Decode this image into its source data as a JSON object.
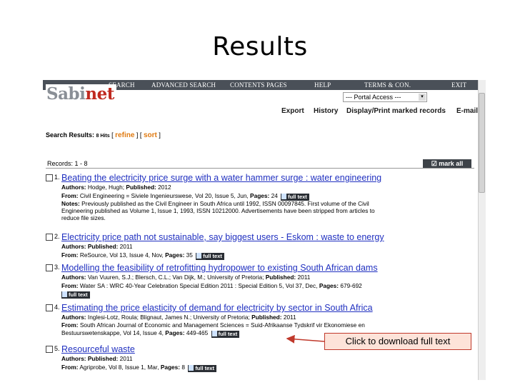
{
  "slide": {
    "title": "Results"
  },
  "nav": {
    "items": [
      "SEARCH",
      "ADVANCED SEARCH",
      "CONTENTS PAGES",
      "HELP",
      "TERMS & CON.",
      "EXIT"
    ],
    "logo_main": "Sabi",
    "logo_accent": "net"
  },
  "portal": {
    "selected": "--- Portal Access ---"
  },
  "toolbar": {
    "export": "Export",
    "history": "History",
    "display_print": "Display/Print marked records",
    "email": "E-mail"
  },
  "search": {
    "label": "Search Results:",
    "hits": "8 Hits",
    "open": "[",
    "refine": "refine",
    "mid": "] [",
    "sort": "sort",
    "close": "]"
  },
  "records_header": {
    "label": "Records: 1 - 8",
    "mark_all": "mark all"
  },
  "full_text_label": "full text",
  "records": [
    {
      "num": "1.",
      "title": "Beating the electricity price surge with a water hammer surge : water engineering",
      "authors_label": "Authors:",
      "authors": "Hodge, Hugh;",
      "published_label": "Published:",
      "published": "2012",
      "from_label": "From:",
      "from": "Civil Engineering = Siviele Ingenieurswese, Vol 20, Issue 5, Jun,",
      "pages_label": "Pages:",
      "pages": "24",
      "notes_label": "Notes:",
      "notes_1": "Previously published as the Civil Engineer in South Africa until 1992, ISSN 00097845. First volume of the Civil",
      "notes_2": "Engineering published as Volume 1, Issue 1, 1993, ISSN 10212000. Advertisements have been stripped from articles to",
      "notes_3": "reduce file sizes."
    },
    {
      "num": "2.",
      "title": "Electricity price path not sustainable, say biggest users - Eskom : waste to energy",
      "authors_label": "Authors:",
      "published_label": "Published:",
      "published": "2011",
      "from_label": "From:",
      "from": "ReSource, Vol 13, Issue 4, Nov,",
      "pages_label": "Pages:",
      "pages": "35"
    },
    {
      "num": "3.",
      "title": "Modelling the feasibility of retrofitting hydropower to existing South African dams",
      "authors_label": "Authors:",
      "authors": "Van Vuuren, S.J.; Blersch, C.L.; Van Dijk, M.; University of Pretoria;",
      "published_label": "Published:",
      "published": "2011",
      "from_label": "From:",
      "from": "Water SA : WRC 40-Year Celebration Special Edition 2011 : Special Edition 5, Vol 37, Dec,",
      "pages_label": "Pages:",
      "pages": "679-692"
    },
    {
      "num": "4.",
      "title": "Estimating the price elasticity of demand for electricity by sector in South Africa",
      "authors_label": "Authors:",
      "authors": "Inglesi-Lotz, Roula; Blignaut, James N.; University of Pretoria;",
      "published_label": "Published:",
      "published": "2011",
      "from_label": "From:",
      "from": "South African Journal of Economic and Management Sciences = Suid-Afrikaanse Tydskrif vir Ekonomiese en",
      "from_2": "Bestuurswetenskappe, Vol 14, Issue 4,",
      "pages_label": "Pages:",
      "pages": "449-465"
    },
    {
      "num": "5.",
      "title": "Resourceful waste",
      "authors_label": "Authors:",
      "published_label": "Published:",
      "published": "2011",
      "from_label": "From:",
      "from": "Agriprobe, Vol 8, Issue 1, Mar,",
      "pages_label": "Pages:",
      "pages": "8"
    }
  ],
  "callout": {
    "text": "Click to download full text"
  },
  "colors": {
    "navbar": "#4a5058",
    "link": "#2030c0",
    "accent_orange": "#e07a10",
    "callout_fill": "#fde3d9",
    "callout_border": "#c0392b"
  }
}
